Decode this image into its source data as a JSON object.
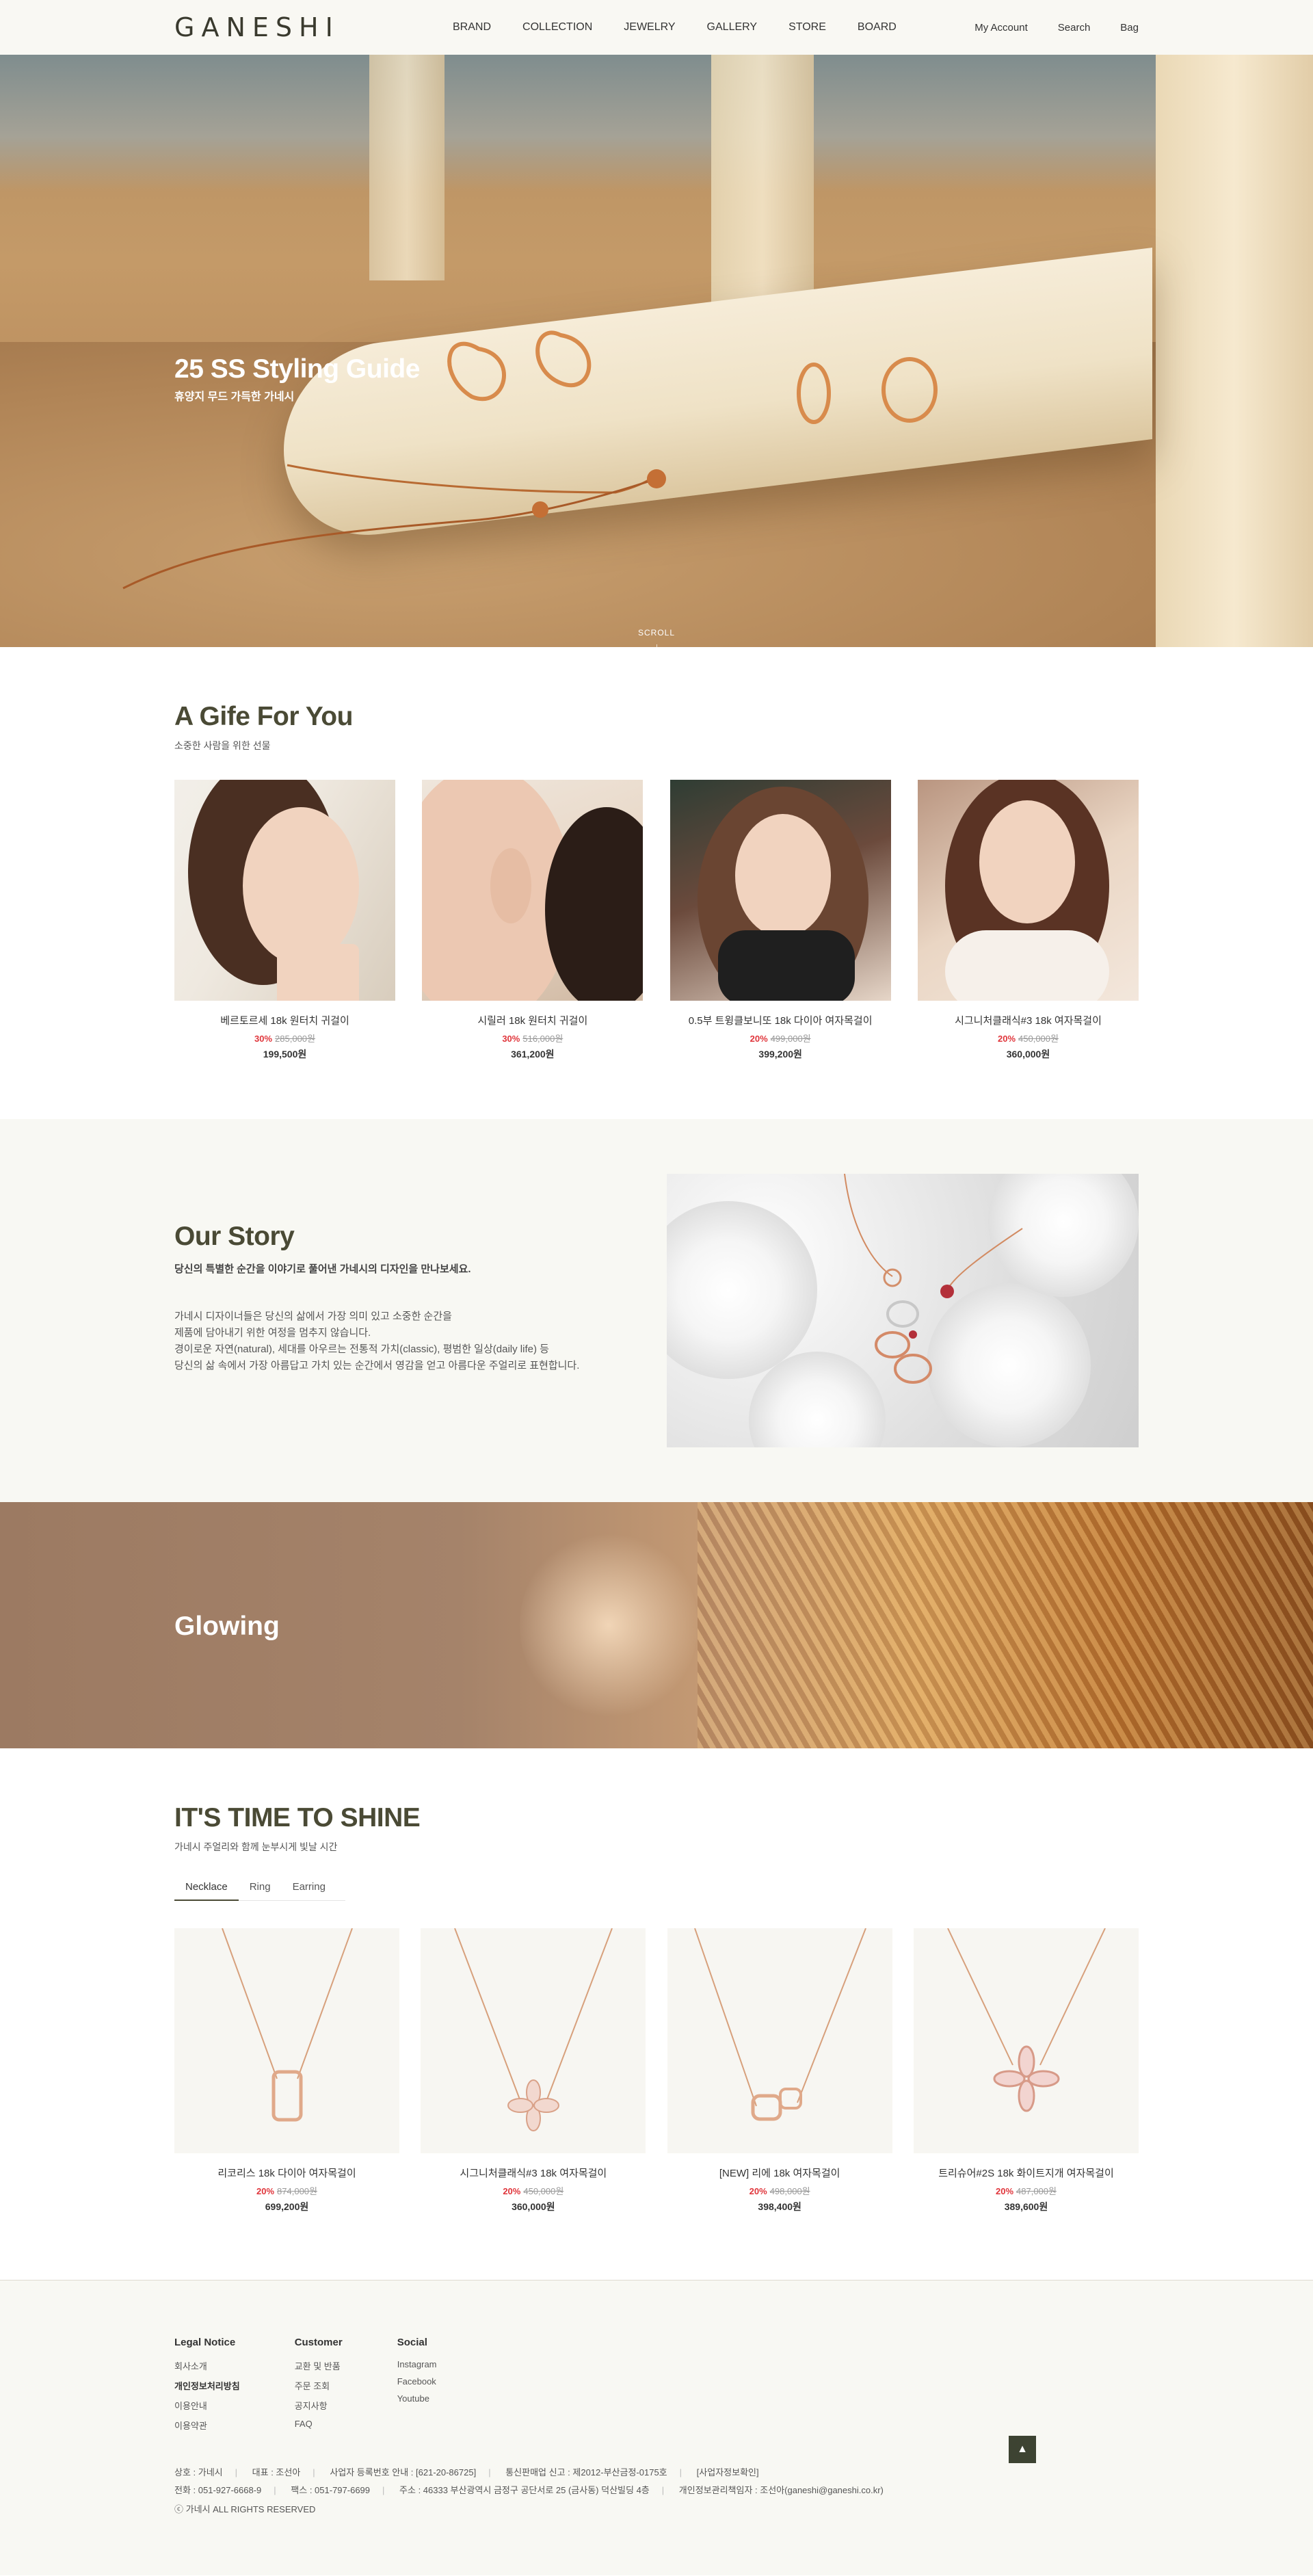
{
  "header": {
    "logo": "GANESHI",
    "nav": [
      "BRAND",
      "COLLECTION",
      "JEWELRY",
      "GALLERY",
      "STORE",
      "BOARD"
    ],
    "util": [
      "My Account",
      "Search",
      "Bag"
    ]
  },
  "hero": {
    "title": "25 SS Styling Guide",
    "subtitle": "휴양지 무드 가득한 가네시",
    "scroll": "SCROLL"
  },
  "gift": {
    "title": "A Gife For You",
    "subtitle": "소중한 사람을 위한 선물",
    "products": [
      {
        "name": "베르토르세 18k 원터치 귀걸이",
        "discount": "30%",
        "original": "285,000원",
        "price": "199,500원"
      },
      {
        "name": "시릴러 18k 원터치 귀걸이",
        "discount": "30%",
        "original": "516,000원",
        "price": "361,200원"
      },
      {
        "name": "0.5부 트윙클보니또 18k 다이아 여자목걸이",
        "discount": "20%",
        "original": "499,000원",
        "price": "399,200원"
      },
      {
        "name": "시그니처클래식#3 18k 여자목걸이",
        "discount": "20%",
        "original": "450,000원",
        "price": "360,000원"
      }
    ]
  },
  "story": {
    "title": "Our Story",
    "lead": "당신의 특별한 순간을 이야기로 풀어낸 가네시의 디자인을 만나보세요.",
    "body": [
      "가네시 디자이너들은 당신의 삶에서 가장 의미 있고 소중한 순간을",
      "제품에 담아내기 위한 여정을 멈추지 않습니다.",
      "경이로운 자연(natural), 세대를 아우르는 전통적 가치(classic), 평범한 일상(daily life) 등",
      "당신의 삶 속에서 가장 아름답고 가치 있는 순간에서 영감을 얻고 아름다운 주얼리로 표현합니다."
    ]
  },
  "glow": {
    "title": "Glowing"
  },
  "shine": {
    "title": "IT'S TIME TO SHINE",
    "subtitle": "가네시 주얼리와 함께 눈부시게 빛날 시간",
    "tabs": [
      "Necklace",
      "Ring",
      "Earring"
    ],
    "products": [
      {
        "name": "리코리스 18k 다이아 여자목걸이",
        "discount": "20%",
        "original": "874,000원",
        "price": "699,200원"
      },
      {
        "name": "시그니처클래식#3 18k 여자목걸이",
        "discount": "20%",
        "original": "450,000원",
        "price": "360,000원"
      },
      {
        "name": "[NEW] 리에 18k 여자목걸이",
        "discount": "20%",
        "original": "498,000원",
        "price": "398,400원"
      },
      {
        "name": "트리슈어#2S 18k 화이트지개 여자목걸이",
        "discount": "20%",
        "original": "487,000원",
        "price": "389,600원"
      }
    ]
  },
  "footer": {
    "cols": [
      {
        "title": "Legal Notice",
        "links": [
          "회사소개",
          "개인정보처리방침",
          "이용안내",
          "이용약관"
        ]
      },
      {
        "title": "Customer",
        "links": [
          "교환 및 반품",
          "주문 조회",
          "공지사항",
          "FAQ"
        ]
      },
      {
        "title": "Social",
        "links": [
          "Instagram",
          "Facebook",
          "Youtube"
        ]
      }
    ],
    "info1": [
      "상호 : 가네시",
      "대표 : 조선아",
      "사업자 등록번호 안내 : [621-20-86725]",
      "통신판매업 신고 : 제2012-부산금정-0175호",
      "[사업자정보확인]"
    ],
    "info2": [
      "전화 : 051-927-6668-9",
      "팩스 : 051-797-6699",
      "주소 : 46333 부산광역시 금정구 공단서로 25 (금사동) 덕산빌딩 4층",
      "개인정보관리책임자 : 조선아(ganeshi@ganeshi.co.kr)"
    ],
    "copyright": "ⓒ 가네시 ALL RIGHTS RESERVED",
    "top": "▲"
  }
}
